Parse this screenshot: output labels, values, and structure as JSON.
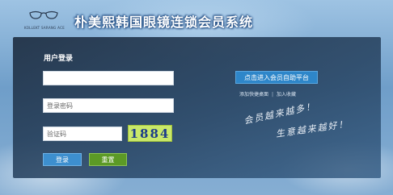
{
  "header": {
    "logo_text": "KOLLEKT SARANG ACE",
    "system_title": "朴美熙韩国眼镜连锁会员系统"
  },
  "login": {
    "title": "用户登录",
    "username_value": "",
    "password_placeholder": "登录密码",
    "captcha_placeholder": "验证码",
    "captcha_code": "1884",
    "login_label": "登录",
    "reset_label": "重置"
  },
  "side": {
    "member_button_label": "点击进入会员自助平台",
    "add_shortcut_label": "添加快捷桌面",
    "separator": "|",
    "add_favorite_label": "加入收藏",
    "slogan_line1": "会员越来越多！",
    "slogan_line2": "生意越来越好！"
  },
  "colors": {
    "panel": "#2a4260",
    "login_button": "#3d8fcf",
    "reset_button": "#5c9a26",
    "captcha_bg": "#c9e86a",
    "member_button": "#2e86c9"
  }
}
